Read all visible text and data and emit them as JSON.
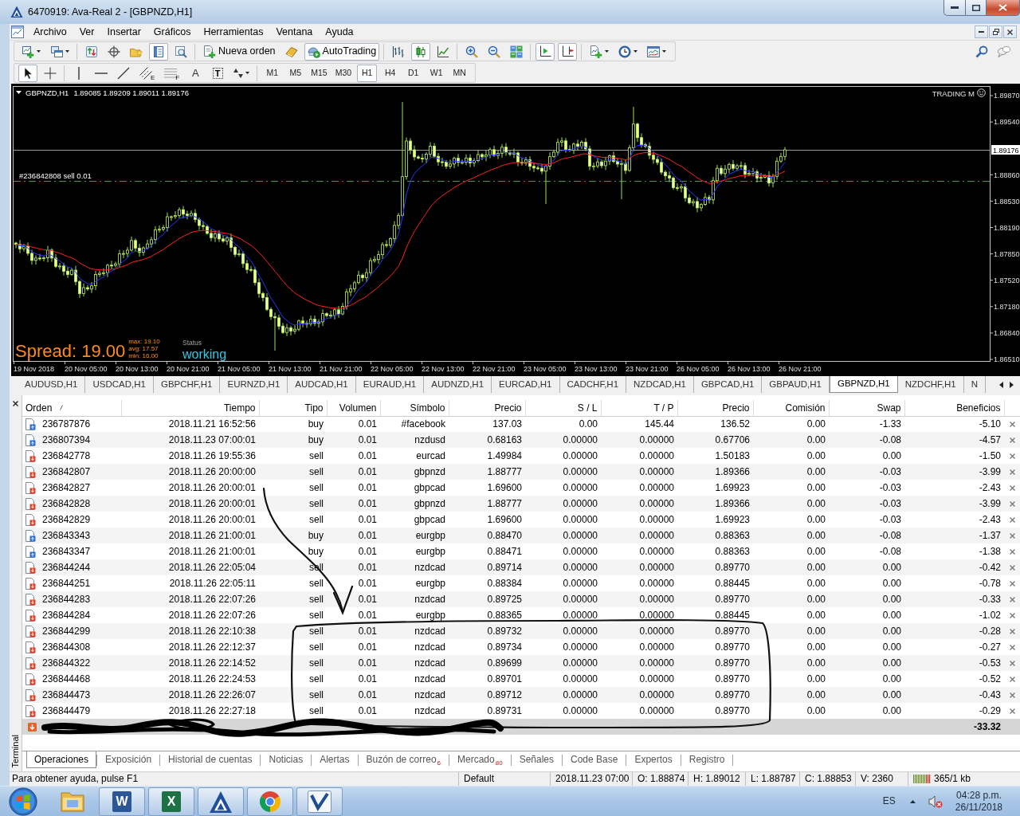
{
  "window": {
    "title": "6470919: Ava-Real 2 - [GBPNZD,H1]"
  },
  "menu": [
    "Archivo",
    "Ver",
    "Insertar",
    "Gráficos",
    "Herramientas",
    "Ventana",
    "Ayuda"
  ],
  "toolbar": [
    {
      "kind": "new_chart",
      "pressed": false
    },
    {
      "kind": "profiles",
      "pressed": false
    },
    {
      "kind": "sep"
    },
    {
      "kind": "market_watch",
      "pressed": false
    },
    {
      "kind": "data_window",
      "pressed": false
    },
    {
      "kind": "navigator",
      "pressed": false
    },
    {
      "kind": "terminal",
      "pressed": true
    },
    {
      "kind": "tester",
      "pressed": false
    },
    {
      "kind": "sep"
    },
    {
      "kind": "new_order",
      "label": "Nueva orden",
      "pressed": false
    },
    {
      "kind": "editor",
      "pressed": false
    },
    {
      "kind": "autotrading",
      "label": "AutoTrading",
      "pressed": true
    },
    {
      "kind": "sep"
    },
    {
      "kind": "bars",
      "pressed": false
    },
    {
      "kind": "candles",
      "pressed": true
    },
    {
      "kind": "line",
      "pressed": false
    },
    {
      "kind": "sep"
    },
    {
      "kind": "zoom_in",
      "pressed": false
    },
    {
      "kind": "zoom_out",
      "pressed": false
    },
    {
      "kind": "tile",
      "pressed": false
    },
    {
      "kind": "sep"
    },
    {
      "kind": "autoscroll",
      "pressed": true
    },
    {
      "kind": "shift",
      "pressed": true
    },
    {
      "kind": "sep"
    },
    {
      "kind": "indicators",
      "pressed": false
    },
    {
      "kind": "periods",
      "pressed": false
    },
    {
      "kind": "templates",
      "pressed": false
    }
  ],
  "toolbar_end": [
    {
      "kind": "search"
    },
    {
      "kind": "chat"
    }
  ],
  "drawing_toolbar": [
    {
      "kind": "cursor",
      "pressed": true
    },
    {
      "kind": "crosshair",
      "pressed": false
    },
    {
      "kind": "sep"
    },
    {
      "kind": "vline",
      "pressed": false
    },
    {
      "kind": "hline",
      "pressed": false
    },
    {
      "kind": "trend",
      "pressed": false
    },
    {
      "kind": "channel",
      "glyph": "E",
      "pressed": false
    },
    {
      "kind": "fibo",
      "glyph": "F",
      "pressed": false
    },
    {
      "kind": "text",
      "glyph": "A",
      "pressed": false
    },
    {
      "kind": "label",
      "glyph": "T",
      "pressed": false
    },
    {
      "kind": "arrows",
      "pressed": false
    },
    {
      "kind": "sep"
    }
  ],
  "timeframes": [
    {
      "label": "M1",
      "selected": false
    },
    {
      "label": "M5",
      "selected": false
    },
    {
      "label": "M15",
      "selected": false
    },
    {
      "label": "M30",
      "selected": false
    },
    {
      "label": "H1",
      "selected": true
    },
    {
      "label": "H4",
      "selected": false
    },
    {
      "label": "D1",
      "selected": false
    },
    {
      "label": "W1",
      "selected": false
    },
    {
      "label": "MN",
      "selected": false
    }
  ],
  "chart": {
    "symbol": "GBPNZD,H1",
    "ohlc": "1.89085 1.89209 1.89011 1.89176",
    "expert": "TRADING M",
    "order_label": "#236842808 sell 0.01",
    "current_price": "1.89176",
    "price_labels": [
      "1.89870",
      "1.89540",
      "1.88860",
      "1.88530",
      "1.88190",
      "1.87850",
      "1.87520",
      "1.87180",
      "1.86840",
      "1.86510"
    ],
    "time_labels": [
      "19 Nov 2018",
      "20 Nov 05:00",
      "20 Nov 13:00",
      "20 Nov 21:00",
      "21 Nov 05:00",
      "21 Nov 13:00",
      "21 Nov 21:00",
      "22 Nov 05:00",
      "22 Nov 13:00",
      "22 Nov 21:00",
      "23 Nov 05:00",
      "23 Nov 13:00",
      "23 Nov 21:00",
      "26 Nov 05:00",
      "26 Nov 13:00",
      "26 Nov 21:00"
    ],
    "spread": {
      "value": "Spread: 19.00",
      "stats": [
        "max: 19.10",
        "avg: 17.57",
        "min: 16.00"
      ]
    },
    "status": {
      "caption": "Status",
      "value": "working"
    }
  },
  "chart_tabs": [
    {
      "label": "AUDUSD,H1",
      "selected": false
    },
    {
      "label": "USDCAD,H1",
      "selected": false
    },
    {
      "label": "GBPCHF,H1",
      "selected": false
    },
    {
      "label": "EURNZD,H1",
      "selected": false
    },
    {
      "label": "AUDCAD,H1",
      "selected": false
    },
    {
      "label": "EURAUD,H1",
      "selected": false
    },
    {
      "label": "AUDNZD,H1",
      "selected": false
    },
    {
      "label": "EURCAD,H1",
      "selected": false
    },
    {
      "label": "CADCHF,H1",
      "selected": false
    },
    {
      "label": "NZDCAD,H1",
      "selected": false
    },
    {
      "label": "GBPCAD,H1",
      "selected": false
    },
    {
      "label": "GBPAUD,H1",
      "selected": false
    },
    {
      "label": "GBPNZD,H1",
      "selected": true
    },
    {
      "label": "NZDCHF,H1",
      "selected": false
    },
    {
      "label": "N",
      "selected": false
    }
  ],
  "terminal": {
    "title": "Terminal",
    "columns": [
      {
        "label": "Orden",
        "sorted": true
      },
      {
        "label": "Tiempo",
        "sorted": false
      },
      {
        "label": "Tipo",
        "sorted": false
      },
      {
        "label": "Volumen",
        "sorted": false
      },
      {
        "label": "Símbolo",
        "sorted": false
      },
      {
        "label": "Precio",
        "sorted": false
      },
      {
        "label": "S / L",
        "sorted": false
      },
      {
        "label": "T / P",
        "sorted": false
      },
      {
        "label": "Precio",
        "sorted": false
      },
      {
        "label": "Comisión",
        "sorted": false
      },
      {
        "label": "Swap",
        "sorted": false
      },
      {
        "label": "Beneficios",
        "sorted": false
      }
    ],
    "rows": [
      {
        "kind": "buy",
        "cells": [
          "236787876",
          "2018.11.21 16:52:56",
          "buy",
          "0.01",
          "#facebook",
          "137.03",
          "0.00",
          "145.44",
          "136.52",
          "0.00",
          "-1.33",
          "-5.10"
        ]
      },
      {
        "kind": "buy",
        "cells": [
          "236807394",
          "2018.11.23 07:00:01",
          "buy",
          "0.01",
          "nzdusd",
          "0.68163",
          "0.00000",
          "0.00000",
          "0.67706",
          "0.00",
          "-0.08",
          "-4.57"
        ]
      },
      {
        "kind": "sell",
        "cells": [
          "236842778",
          "2018.11.26 19:55:36",
          "sell",
          "0.01",
          "eurcad",
          "1.49984",
          "0.00000",
          "0.00000",
          "1.50183",
          "0.00",
          "0.00",
          "-1.50"
        ]
      },
      {
        "kind": "sell",
        "cells": [
          "236842807",
          "2018.11.26 20:00:00",
          "sell",
          "0.01",
          "gbpnzd",
          "1.88777",
          "0.00000",
          "0.00000",
          "1.89366",
          "0.00",
          "-0.03",
          "-3.99"
        ]
      },
      {
        "kind": "sell",
        "cells": [
          "236842827",
          "2018.11.26 20:00:01",
          "sell",
          "0.01",
          "gbpcad",
          "1.69600",
          "0.00000",
          "0.00000",
          "1.69923",
          "0.00",
          "-0.03",
          "-2.43"
        ]
      },
      {
        "kind": "sell",
        "cells": [
          "236842828",
          "2018.11.26 20:00:01",
          "sell",
          "0.01",
          "gbpnzd",
          "1.88777",
          "0.00000",
          "0.00000",
          "1.89366",
          "0.00",
          "-0.03",
          "-3.99"
        ]
      },
      {
        "kind": "sell",
        "cells": [
          "236842829",
          "2018.11.26 20:00:01",
          "sell",
          "0.01",
          "gbpcad",
          "1.69600",
          "0.00000",
          "0.00000",
          "1.69923",
          "0.00",
          "-0.03",
          "-2.43"
        ]
      },
      {
        "kind": "buy",
        "cells": [
          "236843343",
          "2018.11.26 21:00:01",
          "buy",
          "0.01",
          "eurgbp",
          "0.88470",
          "0.00000",
          "0.00000",
          "0.88363",
          "0.00",
          "-0.08",
          "-1.37"
        ]
      },
      {
        "kind": "buy",
        "cells": [
          "236843347",
          "2018.11.26 21:00:01",
          "buy",
          "0.01",
          "eurgbp",
          "0.88471",
          "0.00000",
          "0.00000",
          "0.88363",
          "0.00",
          "-0.08",
          "-1.38"
        ]
      },
      {
        "kind": "sell",
        "cells": [
          "236844244",
          "2018.11.26 22:05:04",
          "sell",
          "0.01",
          "nzdcad",
          "0.89714",
          "0.00000",
          "0.00000",
          "0.89770",
          "0.00",
          "0.00",
          "-0.42"
        ]
      },
      {
        "kind": "sell",
        "cells": [
          "236844251",
          "2018.11.26 22:05:11",
          "sell",
          "0.01",
          "eurgbp",
          "0.88384",
          "0.00000",
          "0.00000",
          "0.88445",
          "0.00",
          "0.00",
          "-0.78"
        ]
      },
      {
        "kind": "sell",
        "cells": [
          "236844283",
          "2018.11.26 22:07:26",
          "sell",
          "0.01",
          "nzdcad",
          "0.89725",
          "0.00000",
          "0.00000",
          "0.89770",
          "0.00",
          "0.00",
          "-0.33"
        ]
      },
      {
        "kind": "sell",
        "cells": [
          "236844284",
          "2018.11.26 22:07:26",
          "sell",
          "0.01",
          "eurgbp",
          "0.88365",
          "0.00000",
          "0.00000",
          "0.88445",
          "0.00",
          "0.00",
          "-1.02"
        ]
      },
      {
        "kind": "sell",
        "cells": [
          "236844299",
          "2018.11.26 22:10:38",
          "sell",
          "0.01",
          "nzdcad",
          "0.89732",
          "0.00000",
          "0.00000",
          "0.89770",
          "0.00",
          "0.00",
          "-0.28"
        ]
      },
      {
        "kind": "sell",
        "cells": [
          "236844308",
          "2018.11.26 22:12:37",
          "sell",
          "0.01",
          "nzdcad",
          "0.89734",
          "0.00000",
          "0.00000",
          "0.89770",
          "0.00",
          "0.00",
          "-0.27"
        ]
      },
      {
        "kind": "sell",
        "cells": [
          "236844322",
          "2018.11.26 22:14:52",
          "sell",
          "0.01",
          "nzdcad",
          "0.89699",
          "0.00000",
          "0.00000",
          "0.89770",
          "0.00",
          "0.00",
          "-0.53"
        ]
      },
      {
        "kind": "sell",
        "cells": [
          "236844468",
          "2018.11.26 22:24:53",
          "sell",
          "0.01",
          "nzdcad",
          "0.89701",
          "0.00000",
          "0.00000",
          "0.89770",
          "0.00",
          "0.00",
          "-0.52"
        ]
      },
      {
        "kind": "sell",
        "cells": [
          "236844473",
          "2018.11.26 22:26:07",
          "sell",
          "0.01",
          "nzdcad",
          "0.89712",
          "0.00000",
          "0.00000",
          "0.89770",
          "0.00",
          "0.00",
          "-0.43"
        ]
      },
      {
        "kind": "sell",
        "cells": [
          "236844479",
          "2018.11.26 22:27:18",
          "sell",
          "0.01",
          "nzdcad",
          "0.89731",
          "0.00000",
          "0.00000",
          "0.89770",
          "0.00",
          "0.00",
          "-0.29"
        ]
      }
    ],
    "summary": {
      "profit": "-33.32"
    },
    "tabs": [
      {
        "label": "Operaciones",
        "selected": true
      },
      {
        "label": "Exposición",
        "selected": false
      },
      {
        "label": "Historial de cuentas",
        "selected": false
      },
      {
        "label": "Noticias",
        "selected": false
      },
      {
        "label": "Alertas",
        "selected": false
      },
      {
        "label": "Buzón de correo",
        "badge": "6",
        "selected": false
      },
      {
        "label": "Mercado",
        "badge": "80",
        "selected": false
      },
      {
        "label": "Señales",
        "selected": false
      },
      {
        "label": "Code Base",
        "selected": false
      },
      {
        "label": "Expertos",
        "selected": false
      },
      {
        "label": "Registro",
        "selected": false
      }
    ]
  },
  "status_bar": {
    "help": "Para obtener ayuda, pulse F1",
    "profile": "Default",
    "bar_time": "2018.11.23 07:00",
    "open": "O: 1.88874",
    "high": "H: 1.89012",
    "low": "L: 1.88787",
    "close": "C: 1.88853",
    "volume": "V: 2360",
    "traffic": "365/1 kb"
  },
  "taskbar": {
    "apps": [
      {
        "kind": "folder",
        "running": false
      },
      {
        "kind": "word",
        "glyph": "W",
        "running": true
      },
      {
        "kind": "excel",
        "glyph": "X",
        "running": true
      },
      {
        "kind": "ava",
        "running": true
      },
      {
        "kind": "chrome",
        "running": true
      },
      {
        "kind": "check",
        "running": true
      }
    ],
    "language": "ES",
    "time": "04:28 p.m.",
    "date": "26/11/2018"
  }
}
